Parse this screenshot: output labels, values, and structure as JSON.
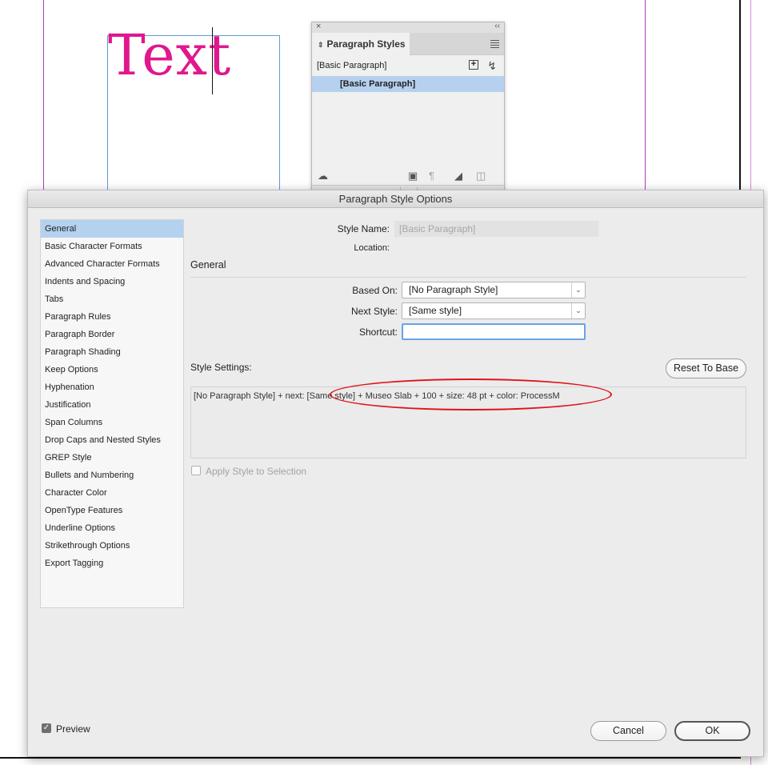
{
  "canvas": {
    "sample_text": "Text",
    "sample_text_color": "#e0178d"
  },
  "paragraph_styles_panel": {
    "close_glyph": "×",
    "collapse_glyph": "‹‹",
    "tab_label": "Paragraph Styles",
    "current_style": "[Basic Paragraph]",
    "new_style_glyph": "+",
    "items": [
      {
        "label": "[Basic Paragraph]",
        "selected": true
      }
    ],
    "footer_icons": [
      "cloud-library-icon",
      "folder-icon",
      "clear-overrides-icon",
      "new-style-icon",
      "trash-icon"
    ]
  },
  "dialog": {
    "title": "Paragraph Style Options",
    "sidebar": {
      "items": [
        "General",
        "Basic Character Formats",
        "Advanced Character Formats",
        "Indents and Spacing",
        "Tabs",
        "Paragraph Rules",
        "Paragraph Border",
        "Paragraph Shading",
        "Keep Options",
        "Hyphenation",
        "Justification",
        "Span Columns",
        "Drop Caps and Nested Styles",
        "GREP Style",
        "Bullets and Numbering",
        "Character Color",
        "OpenType Features",
        "Underline Options",
        "Strikethrough Options",
        "Export Tagging"
      ],
      "selected": "General"
    },
    "style_name_label": "Style Name:",
    "style_name_value": "[Basic Paragraph]",
    "location_label": "Location:",
    "section_title": "General",
    "based_on_label": "Based On:",
    "based_on_value": "[No Paragraph Style]",
    "next_style_label": "Next Style:",
    "next_style_value": "[Same style]",
    "shortcut_label": "Shortcut:",
    "shortcut_value": "",
    "style_settings_label": "Style Settings:",
    "reset_button": "Reset To Base",
    "style_settings_text": "[No Paragraph Style] + next: [Same style] + Museo Slab + 100 + size: 48 pt + color: ProcessM",
    "apply_label": "Apply Style to Selection",
    "apply_checked": false,
    "preview_label": "Preview",
    "preview_checked": true,
    "cancel_button": "Cancel",
    "ok_button": "OK",
    "annotation_color": "#e0131c"
  }
}
